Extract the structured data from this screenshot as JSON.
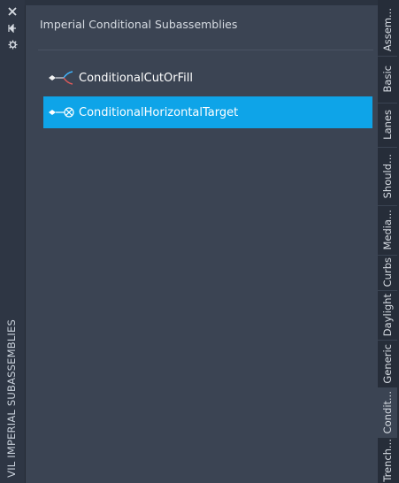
{
  "left_strip": {
    "icons": [
      "close-icon",
      "collapse-icon",
      "settings-icon"
    ],
    "palette_title": "VIL IMPERIAL SUBASSEMBLIES"
  },
  "panel": {
    "title": "Imperial Conditional Subassemblies",
    "items": [
      {
        "label": "ConditionalCutOrFill",
        "icon": "cut-fill-branch-icon",
        "selected": false
      },
      {
        "label": "ConditionalHorizontalTarget",
        "icon": "horizontal-target-icon",
        "selected": true
      }
    ]
  },
  "tabs": [
    {
      "label": "Assem...",
      "active": false
    },
    {
      "label": "Basic",
      "active": false
    },
    {
      "label": "Lanes",
      "active": false
    },
    {
      "label": "Should...",
      "active": false
    },
    {
      "label": "Media...",
      "active": false
    },
    {
      "label": "Curbs",
      "active": false
    },
    {
      "label": "Daylight",
      "active": false
    },
    {
      "label": "Generic",
      "active": false
    },
    {
      "label": "Condit...",
      "active": true
    },
    {
      "label": "Trench...",
      "active": false
    }
  ],
  "colors": {
    "selection": "#0ea4e8",
    "panel_bg": "#3b4453",
    "strip_bg": "#2b3340"
  }
}
